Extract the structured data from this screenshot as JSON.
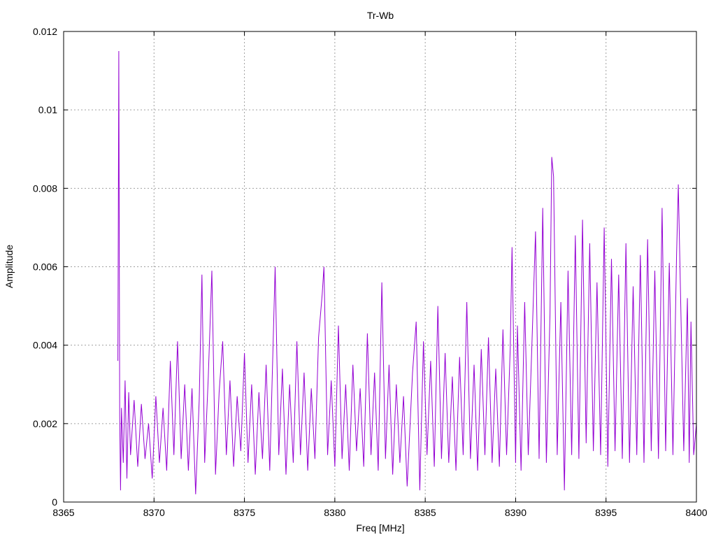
{
  "chart_data": {
    "type": "line",
    "title": "Tr-Wb",
    "xlabel": "Freq [MHz]",
    "ylabel": "Amplitude",
    "xlim": [
      8365,
      8400
    ],
    "ylim": [
      0,
      0.012
    ],
    "xticks": [
      "8365",
      "8370",
      "8375",
      "8380",
      "8385",
      "8390",
      "8395",
      "8400"
    ],
    "yticks": [
      "0",
      "0.002",
      "0.004",
      "0.006",
      "0.008",
      "0.01",
      "0.012"
    ],
    "grid": true,
    "legend": "none",
    "series": [
      {
        "color": "#9400d3",
        "points": [
          [
            8368.0,
            0.0036
          ],
          [
            8368.05,
            0.0115
          ],
          [
            8368.1,
            0.0022
          ],
          [
            8368.15,
            0.0003
          ],
          [
            8368.2,
            0.0024
          ],
          [
            8368.3,
            0.001
          ],
          [
            8368.4,
            0.0031
          ],
          [
            8368.5,
            0.0006
          ],
          [
            8368.6,
            0.0028
          ],
          [
            8368.7,
            0.0012
          ],
          [
            8368.9,
            0.0026
          ],
          [
            8369.1,
            0.0009
          ],
          [
            8369.3,
            0.0025
          ],
          [
            8369.5,
            0.0011
          ],
          [
            8369.7,
            0.002
          ],
          [
            8369.9,
            0.0006
          ],
          [
            8370.1,
            0.0027
          ],
          [
            8370.3,
            0.001
          ],
          [
            8370.5,
            0.0024
          ],
          [
            8370.7,
            0.0008
          ],
          [
            8370.9,
            0.0036
          ],
          [
            8371.1,
            0.0012
          ],
          [
            8371.3,
            0.0041
          ],
          [
            8371.5,
            0.0011
          ],
          [
            8371.7,
            0.003
          ],
          [
            8371.9,
            0.0008
          ],
          [
            8372.1,
            0.0029
          ],
          [
            8372.3,
            0.0002
          ],
          [
            8372.5,
            0.0026
          ],
          [
            8372.65,
            0.0058
          ],
          [
            8372.8,
            0.001
          ],
          [
            8373.0,
            0.0032
          ],
          [
            8373.2,
            0.0059
          ],
          [
            8373.4,
            0.0007
          ],
          [
            8373.6,
            0.0028
          ],
          [
            8373.8,
            0.0041
          ],
          [
            8374.0,
            0.0012
          ],
          [
            8374.2,
            0.0031
          ],
          [
            8374.4,
            0.0009
          ],
          [
            8374.6,
            0.0027
          ],
          [
            8374.8,
            0.0013
          ],
          [
            8375.0,
            0.0038
          ],
          [
            8375.2,
            0.001
          ],
          [
            8375.4,
            0.003
          ],
          [
            8375.6,
            0.0007
          ],
          [
            8375.8,
            0.0028
          ],
          [
            8376.0,
            0.0011
          ],
          [
            8376.2,
            0.0035
          ],
          [
            8376.4,
            0.0008
          ],
          [
            8376.7,
            0.006
          ],
          [
            8376.9,
            0.0012
          ],
          [
            8377.1,
            0.0034
          ],
          [
            8377.3,
            0.0007
          ],
          [
            8377.5,
            0.003
          ],
          [
            8377.7,
            0.001
          ],
          [
            8377.9,
            0.0041
          ],
          [
            8378.1,
            0.0012
          ],
          [
            8378.3,
            0.0033
          ],
          [
            8378.5,
            0.0008
          ],
          [
            8378.7,
            0.0029
          ],
          [
            8378.9,
            0.0011
          ],
          [
            8379.1,
            0.0042
          ],
          [
            8379.3,
            0.0053
          ],
          [
            8379.4,
            0.006
          ],
          [
            8379.6,
            0.0012
          ],
          [
            8379.8,
            0.0031
          ],
          [
            8380.0,
            0.0009
          ],
          [
            8380.2,
            0.0045
          ],
          [
            8380.4,
            0.0011
          ],
          [
            8380.6,
            0.003
          ],
          [
            8380.8,
            0.0008
          ],
          [
            8381.0,
            0.0035
          ],
          [
            8381.2,
            0.0013
          ],
          [
            8381.4,
            0.0029
          ],
          [
            8381.6,
            0.0009
          ],
          [
            8381.8,
            0.0043
          ],
          [
            8382.0,
            0.0012
          ],
          [
            8382.2,
            0.0033
          ],
          [
            8382.4,
            0.0008
          ],
          [
            8382.6,
            0.0056
          ],
          [
            8382.8,
            0.0011
          ],
          [
            8383.0,
            0.0035
          ],
          [
            8383.2,
            0.0007
          ],
          [
            8383.4,
            0.003
          ],
          [
            8383.6,
            0.001
          ],
          [
            8383.8,
            0.0027
          ],
          [
            8384.0,
            0.0004
          ],
          [
            8384.3,
            0.0033
          ],
          [
            8384.5,
            0.0046
          ],
          [
            8384.7,
            0.0003
          ],
          [
            8384.9,
            0.0041
          ],
          [
            8385.1,
            0.0012
          ],
          [
            8385.3,
            0.0036
          ],
          [
            8385.5,
            0.0009
          ],
          [
            8385.7,
            0.005
          ],
          [
            8385.9,
            0.0011
          ],
          [
            8386.1,
            0.0038
          ],
          [
            8386.3,
            0.001
          ],
          [
            8386.5,
            0.0032
          ],
          [
            8386.7,
            0.0008
          ],
          [
            8386.9,
            0.0037
          ],
          [
            8387.1,
            0.0012
          ],
          [
            8387.3,
            0.0051
          ],
          [
            8387.5,
            0.0011
          ],
          [
            8387.7,
            0.0035
          ],
          [
            8387.9,
            0.0008
          ],
          [
            8388.1,
            0.0039
          ],
          [
            8388.3,
            0.0012
          ],
          [
            8388.5,
            0.0042
          ],
          [
            8388.7,
            0.001
          ],
          [
            8388.9,
            0.0034
          ],
          [
            8389.1,
            0.0009
          ],
          [
            8389.3,
            0.0044
          ],
          [
            8389.5,
            0.0012
          ],
          [
            8389.7,
            0.0039
          ],
          [
            8389.8,
            0.0065
          ],
          [
            8390.0,
            0.001
          ],
          [
            8390.1,
            0.0045
          ],
          [
            8390.3,
            0.0008
          ],
          [
            8390.5,
            0.0051
          ],
          [
            8390.7,
            0.0012
          ],
          [
            8390.9,
            0.004
          ],
          [
            8391.1,
            0.0069
          ],
          [
            8391.3,
            0.0011
          ],
          [
            8391.5,
            0.0075
          ],
          [
            8391.7,
            0.001
          ],
          [
            8391.9,
            0.0048
          ],
          [
            8392.0,
            0.0088
          ],
          [
            8392.1,
            0.0083
          ],
          [
            8392.3,
            0.0012
          ],
          [
            8392.5,
            0.0051
          ],
          [
            8392.7,
            0.0003
          ],
          [
            8392.9,
            0.0059
          ],
          [
            8393.1,
            0.0012
          ],
          [
            8393.3,
            0.0068
          ],
          [
            8393.5,
            0.0011
          ],
          [
            8393.7,
            0.0072
          ],
          [
            8393.9,
            0.0015
          ],
          [
            8394.1,
            0.0066
          ],
          [
            8394.3,
            0.0013
          ],
          [
            8394.5,
            0.0056
          ],
          [
            8394.7,
            0.0012
          ],
          [
            8394.9,
            0.007
          ],
          [
            8395.1,
            0.0009
          ],
          [
            8395.3,
            0.0062
          ],
          [
            8395.5,
            0.0013
          ],
          [
            8395.7,
            0.0058
          ],
          [
            8395.9,
            0.0011
          ],
          [
            8396.1,
            0.0066
          ],
          [
            8396.3,
            0.001
          ],
          [
            8396.5,
            0.0055
          ],
          [
            8396.7,
            0.0012
          ],
          [
            8396.9,
            0.0063
          ],
          [
            8397.1,
            0.001
          ],
          [
            8397.3,
            0.0067
          ],
          [
            8397.5,
            0.0013
          ],
          [
            8397.7,
            0.0059
          ],
          [
            8397.9,
            0.0011
          ],
          [
            8398.1,
            0.0075
          ],
          [
            8398.3,
            0.0013
          ],
          [
            8398.5,
            0.0061
          ],
          [
            8398.7,
            0.0012
          ],
          [
            8398.9,
            0.0063
          ],
          [
            8399.0,
            0.0081
          ],
          [
            8399.1,
            0.0058
          ],
          [
            8399.3,
            0.0013
          ],
          [
            8399.5,
            0.0052
          ],
          [
            8399.6,
            0.001
          ],
          [
            8399.7,
            0.0046
          ],
          [
            8399.85,
            0.0012
          ],
          [
            8400.0,
            0.002
          ]
        ]
      }
    ]
  }
}
